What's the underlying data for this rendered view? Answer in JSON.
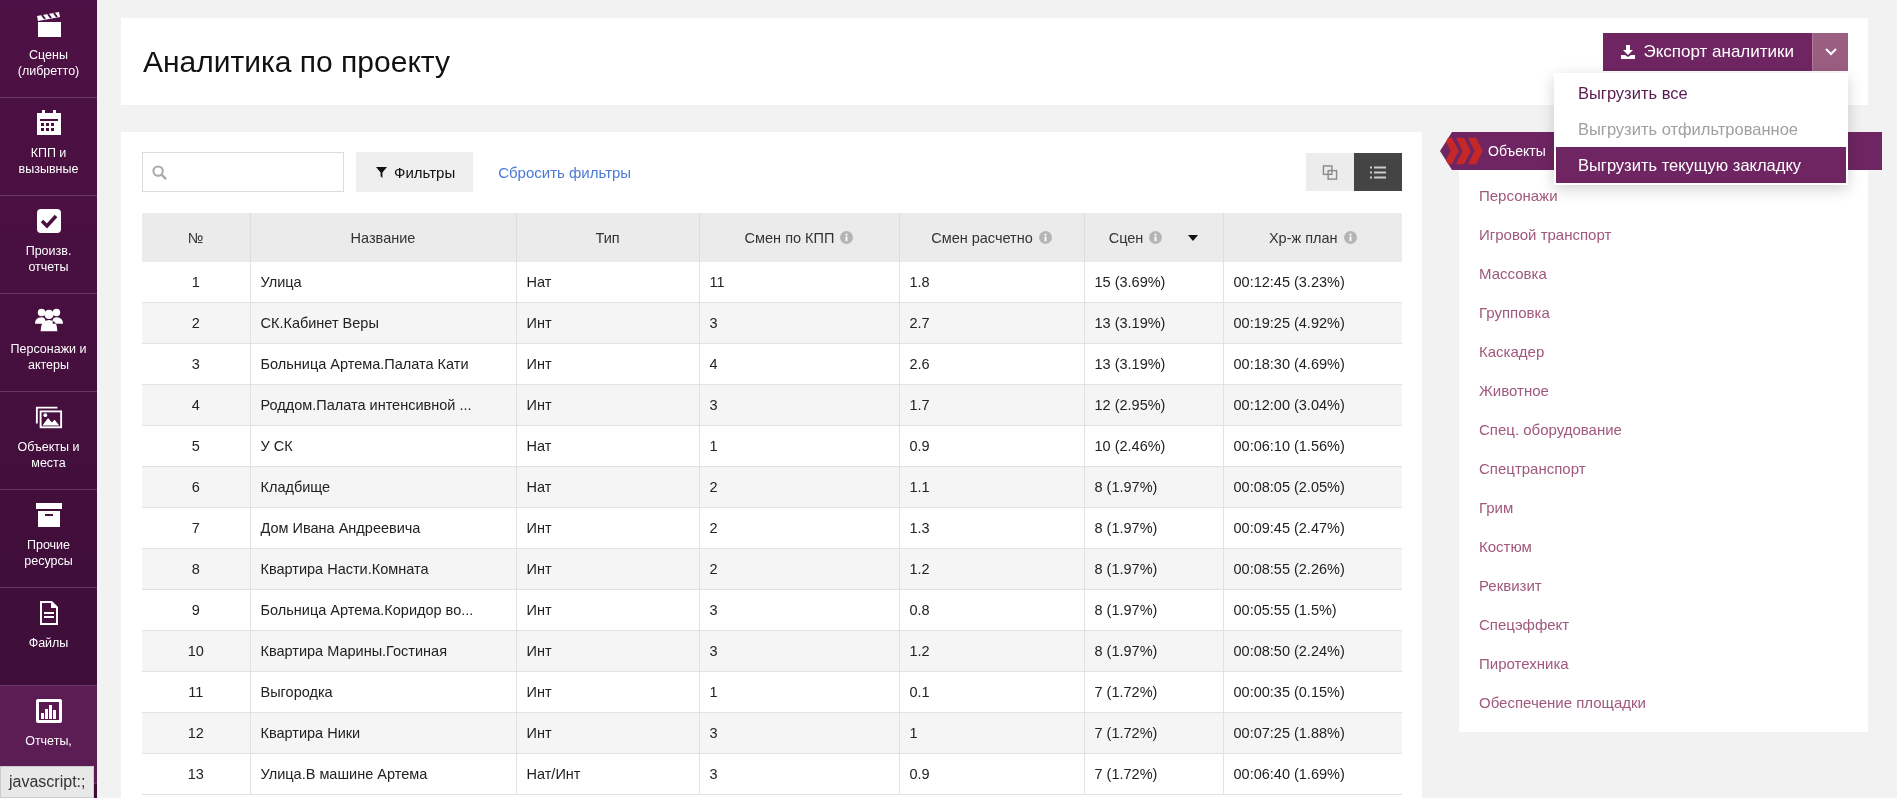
{
  "sidebar": {
    "items": [
      {
        "label": "Сцены (либретто)",
        "selected": false
      },
      {
        "label": "КПП и вызывные",
        "selected": false
      },
      {
        "label": "Произв. отчеты",
        "selected": false
      },
      {
        "label": "Персонажи и актеры",
        "selected": false
      },
      {
        "label": "Объекты и места",
        "selected": false
      },
      {
        "label": "Прочие ресурсы",
        "selected": false
      },
      {
        "label": "Файлы",
        "selected": false
      },
      {
        "label": "Отчеты,",
        "selected": true
      }
    ]
  },
  "page": {
    "title": "Аналитика по проекту"
  },
  "export": {
    "label": "Экспорт аналитики",
    "menu": [
      {
        "label": "Выгрузить все",
        "disabled": false,
        "selected": false
      },
      {
        "label": "Выгрузить отфильтрованное",
        "disabled": true,
        "selected": false
      },
      {
        "label": "Выгрузить текущую закладку",
        "disabled": false,
        "selected": true
      }
    ]
  },
  "toolbar": {
    "filters_button": "Фильтры",
    "reset_link": "Сбросить фильтры",
    "view_toggle": [
      {
        "selected": false
      },
      {
        "selected": true
      }
    ]
  },
  "table": {
    "columns": [
      {
        "label": "№",
        "info": false,
        "sorted": false
      },
      {
        "label": "Название",
        "info": false,
        "sorted": false
      },
      {
        "label": "Тип",
        "info": false,
        "sorted": false
      },
      {
        "label": "Смен по КПП",
        "info": true,
        "sorted": false
      },
      {
        "label": "Смен расчетно",
        "info": true,
        "sorted": false
      },
      {
        "label": "Сцен",
        "info": true,
        "sorted": true
      },
      {
        "label": "Хр-ж план",
        "info": true,
        "sorted": false
      }
    ],
    "rows": [
      [
        "1",
        "Улица",
        "Нат",
        "11",
        "1.8",
        "15 (3.69%)",
        "00:12:45 (3.23%)"
      ],
      [
        "2",
        "СК.Кабинет Веры",
        "Инт",
        "3",
        "2.7",
        "13 (3.19%)",
        "00:19:25 (4.92%)"
      ],
      [
        "3",
        "Больница Артема.Палата Кати",
        "Инт",
        "4",
        "2.6",
        "13 (3.19%)",
        "00:18:30 (4.69%)"
      ],
      [
        "4",
        "Роддом.Палата интенсивной ...",
        "Инт",
        "3",
        "1.7",
        "12 (2.95%)",
        "00:12:00 (3.04%)"
      ],
      [
        "5",
        "У СК",
        "Нат",
        "1",
        "0.9",
        "10 (2.46%)",
        "00:06:10 (1.56%)"
      ],
      [
        "6",
        "Кладбище",
        "Нат",
        "2",
        "1.1",
        "8 (1.97%)",
        "00:08:05 (2.05%)"
      ],
      [
        "7",
        "Дом Ивана Андреевича",
        "Инт",
        "2",
        "1.3",
        "8 (1.97%)",
        "00:09:45 (2.47%)"
      ],
      [
        "8",
        "Квартира Насти.Комната",
        "Инт",
        "2",
        "1.2",
        "8 (1.97%)",
        "00:08:55 (2.26%)"
      ],
      [
        "9",
        "Больница Артема.Коридор во...",
        "Инт",
        "3",
        "0.8",
        "8 (1.97%)",
        "00:05:55 (1.5%)"
      ],
      [
        "10",
        "Квартира Марины.Гостиная",
        "Инт",
        "3",
        "1.2",
        "8 (1.97%)",
        "00:08:50 (2.24%)"
      ],
      [
        "11",
        "Выгородка",
        "Инт",
        "1",
        "0.1",
        "7 (1.72%)",
        "00:00:35 (0.15%)"
      ],
      [
        "12",
        "Квартира Ники",
        "Инт",
        "3",
        "1",
        "7 (1.72%)",
        "00:07:25 (1.88%)"
      ],
      [
        "13",
        "Улица.В машине Артема",
        "Нат/Инт",
        "3",
        "0.9",
        "7 (1.72%)",
        "00:06:40 (1.69%)"
      ]
    ]
  },
  "resources": {
    "header": "Объекты",
    "items": [
      "Персонажи",
      "Игровой транспорт",
      "Массовка",
      "Групповка",
      "Каскадер",
      "Животное",
      "Спец. оборудование",
      "Спецтранспорт",
      "Грим",
      "Костюм",
      "Реквизит",
      "Спецэффект",
      "Пиротехника",
      "Обеспечение площадки"
    ]
  },
  "status_tooltip": "javascript:;"
}
